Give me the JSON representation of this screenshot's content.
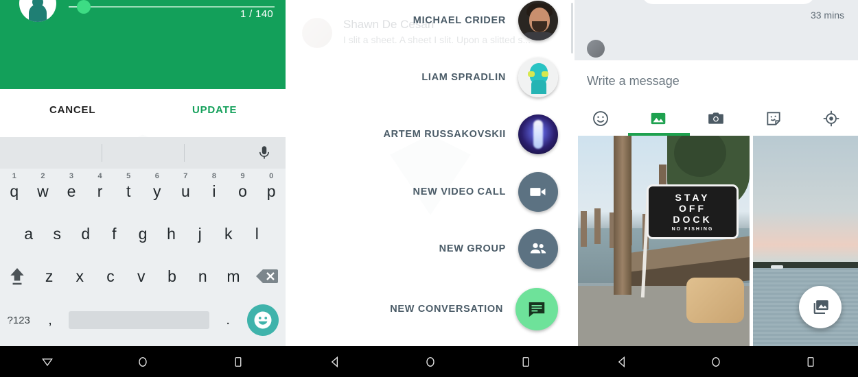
{
  "panel1": {
    "name": "status-editor",
    "slider": {
      "value": 1,
      "max": 140,
      "counter": "1 / 140"
    },
    "avatar_icon": "person-avatar",
    "buttons": {
      "cancel": "CANCEL",
      "update": "UPDATE"
    },
    "colors": {
      "hero_green": "#13a05a",
      "update_green": "#13a05a",
      "thumb_green": "#3ddc84"
    },
    "keyboard": {
      "mic_icon": "microphone-icon",
      "row1": [
        {
          "key": "q",
          "num": "1"
        },
        {
          "key": "w",
          "num": "2"
        },
        {
          "key": "e",
          "num": "3"
        },
        {
          "key": "r",
          "num": "4"
        },
        {
          "key": "t",
          "num": "5"
        },
        {
          "key": "y",
          "num": "6"
        },
        {
          "key": "u",
          "num": "7"
        },
        {
          "key": "i",
          "num": "8"
        },
        {
          "key": "o",
          "num": "9"
        },
        {
          "key": "p",
          "num": "0"
        }
      ],
      "row2": [
        "a",
        "s",
        "d",
        "f",
        "g",
        "h",
        "j",
        "k",
        "l"
      ],
      "row3": [
        "z",
        "x",
        "c",
        "v",
        "b",
        "n",
        "m"
      ],
      "shift_icon": "shift-icon",
      "delete_icon": "backspace-icon",
      "row4": {
        "symbols": "?123",
        "comma": ",",
        "space": "",
        "period": ".",
        "emoji_icon": "emoji-smiley-icon"
      }
    }
  },
  "panel2": {
    "name": "fab-speed-dial",
    "background_conversation": {
      "sender": "Shawn De Cesari",
      "snippet": "I slit a sheet. A sheet I slit. Upon a slitted s..."
    },
    "items": [
      {
        "label": "MICHAEL CRIDER",
        "icon": "avatar-michael-crider",
        "type": "contact"
      },
      {
        "label": "LIAM SPRADLIN",
        "icon": "avatar-liam-spradlin",
        "type": "contact"
      },
      {
        "label": "ARTEM RUSSAKOVSKII",
        "icon": "avatar-artem-russakovskii",
        "type": "contact"
      },
      {
        "label": "NEW VIDEO CALL",
        "icon": "video-camera-icon",
        "type": "action"
      },
      {
        "label": "NEW GROUP",
        "icon": "people-group-icon",
        "type": "action"
      },
      {
        "label": "NEW CONVERSATION",
        "icon": "message-bubble-icon",
        "type": "primary-action"
      }
    ],
    "colors": {
      "action_fab": "#5c7282",
      "primary_fab": "#6ee29a",
      "label": "#4a5b67"
    }
  },
  "panel3": {
    "name": "chat-composer",
    "timestamp": "33 mins",
    "composer_placeholder": "Write a message",
    "attachment_icons": [
      {
        "name": "emoji-smiley-icon",
        "active": false
      },
      {
        "name": "gallery-image-icon",
        "active": true
      },
      {
        "name": "camera-icon",
        "active": false
      },
      {
        "name": "sticker-icon",
        "active": false
      },
      {
        "name": "location-target-icon",
        "active": false
      }
    ],
    "gallery": {
      "photo1": {
        "name": "dock-sign-photo",
        "sign_lines": [
          "STAY",
          "OFF",
          "DOCK"
        ],
        "sign_subtext": "NO FISHING"
      },
      "photo2": {
        "name": "sunset-lake-photo"
      }
    },
    "gallery_fab_icon": "photo-library-icon",
    "colors": {
      "active_green": "#1ea14f",
      "chat_bg": "#e9ecef"
    }
  },
  "navbar": {
    "bars": [
      {
        "back_icon": "keyboard-dismiss-icon",
        "home_icon": "home-circle-icon",
        "recents_icon": "recents-square-icon"
      },
      {
        "back_icon": "back-triangle-icon",
        "home_icon": "home-circle-icon",
        "recents_icon": "recents-square-icon"
      },
      {
        "back_icon": "back-triangle-icon",
        "home_icon": "home-circle-icon",
        "recents_icon": "recents-square-icon"
      }
    ]
  }
}
